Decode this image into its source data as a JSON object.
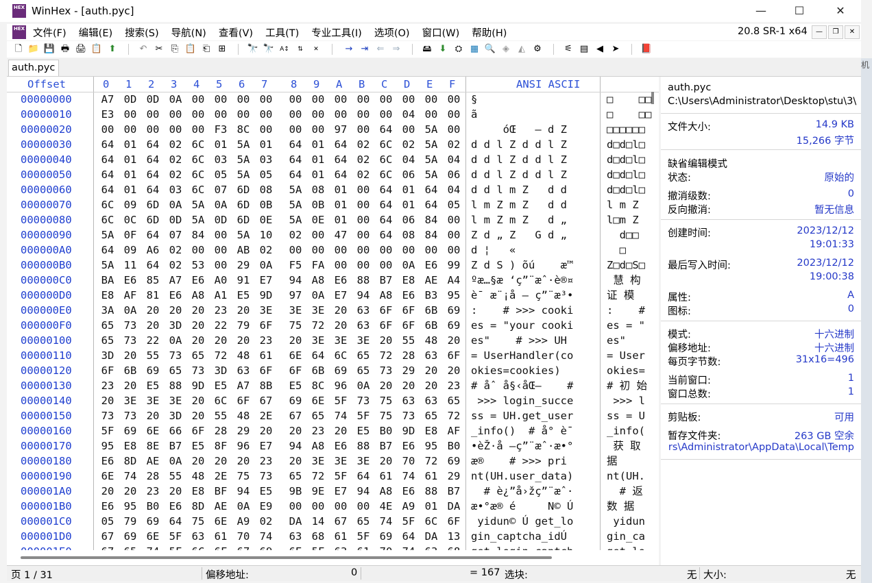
{
  "window": {
    "title": "WinHex - [auth.pyc]",
    "logo_text": "HEX",
    "minimize": "—",
    "maximize": "☐",
    "close": "✕"
  },
  "menu": {
    "items": [
      "文件(F)",
      "编辑(E)",
      "搜索(S)",
      "导航(N)",
      "查看(V)",
      "工具(T)",
      "专业工具(I)",
      "选项(O)",
      "窗口(W)",
      "帮助(H)"
    ],
    "version": "20.8 SR-1 x64"
  },
  "tab": {
    "label": "auth.pyc"
  },
  "side_fragment": "机",
  "hex": {
    "offset_header": "Offset",
    "columns": [
      "0",
      "1",
      "2",
      "3",
      "4",
      "5",
      "6",
      "7",
      "8",
      "9",
      "A",
      "B",
      "C",
      "D",
      "E",
      "F"
    ],
    "ansi_header": "ANSI ASCII",
    "rows": [
      {
        "offset": "00000000",
        "bytes": [
          "A7",
          "0D",
          "0D",
          "0A",
          "00",
          "00",
          "00",
          "00",
          "00",
          "00",
          "00",
          "00",
          "00",
          "00",
          "00",
          "00"
        ],
        "ansi": "§",
        "ascii": "□    □□"
      },
      {
        "offset": "00000010",
        "bytes": [
          "E3",
          "00",
          "00",
          "00",
          "00",
          "00",
          "00",
          "00",
          "00",
          "00",
          "00",
          "00",
          "00",
          "04",
          "00",
          "00"
        ],
        "ansi": "ã",
        "ascii": "□    □□"
      },
      {
        "offset": "00000020",
        "bytes": [
          "00",
          "00",
          "00",
          "00",
          "00",
          "F3",
          "8C",
          "00",
          "00",
          "00",
          "97",
          "00",
          "64",
          "00",
          "5A",
          "00"
        ],
        "ansi": "     óŒ   — d Z",
        "ascii": "□□□□□□"
      },
      {
        "offset": "00000030",
        "bytes": [
          "64",
          "01",
          "64",
          "02",
          "6C",
          "01",
          "5A",
          "01",
          "64",
          "01",
          "64",
          "02",
          "6C",
          "02",
          "5A",
          "02"
        ],
        "ansi": "d d l Z d d l Z",
        "ascii": "d□d□l□"
      },
      {
        "offset": "00000040",
        "bytes": [
          "64",
          "01",
          "64",
          "02",
          "6C",
          "03",
          "5A",
          "03",
          "64",
          "01",
          "64",
          "02",
          "6C",
          "04",
          "5A",
          "04"
        ],
        "ansi": "d d l Z d d l Z",
        "ascii": "d□d□l□"
      },
      {
        "offset": "00000050",
        "bytes": [
          "64",
          "01",
          "64",
          "02",
          "6C",
          "05",
          "5A",
          "05",
          "64",
          "01",
          "64",
          "02",
          "6C",
          "06",
          "5A",
          "06"
        ],
        "ansi": "d d l Z d d l Z",
        "ascii": "d□d□l□"
      },
      {
        "offset": "00000060",
        "bytes": [
          "64",
          "01",
          "64",
          "03",
          "6C",
          "07",
          "6D",
          "08",
          "5A",
          "08",
          "01",
          "00",
          "64",
          "01",
          "64",
          "04"
        ],
        "ansi": "d d l m Z   d d",
        "ascii": "d□d□l□"
      },
      {
        "offset": "00000070",
        "bytes": [
          "6C",
          "09",
          "6D",
          "0A",
          "5A",
          "0A",
          "6D",
          "0B",
          "5A",
          "0B",
          "01",
          "00",
          "64",
          "01",
          "64",
          "05"
        ],
        "ansi": "l m Z m Z   d d",
        "ascii": "l m Z"
      },
      {
        "offset": "00000080",
        "bytes": [
          "6C",
          "0C",
          "6D",
          "0D",
          "5A",
          "0D",
          "6D",
          "0E",
          "5A",
          "0E",
          "01",
          "00",
          "64",
          "06",
          "84",
          "00"
        ],
        "ansi": "l m Z m Z   d „",
        "ascii": "l□m Z"
      },
      {
        "offset": "00000090",
        "bytes": [
          "5A",
          "0F",
          "64",
          "07",
          "84",
          "00",
          "5A",
          "10",
          "02",
          "00",
          "47",
          "00",
          "64",
          "08",
          "84",
          "00"
        ],
        "ansi": "Z d „ Z   G d „",
        "ascii": "  d□□"
      },
      {
        "offset": "000000A0",
        "bytes": [
          "64",
          "09",
          "A6",
          "02",
          "00",
          "00",
          "AB",
          "02",
          "00",
          "00",
          "00",
          "00",
          "00",
          "00",
          "00",
          "00"
        ],
        "ansi": "d ¦   «",
        "ascii": "  □"
      },
      {
        "offset": "000000B0",
        "bytes": [
          "5A",
          "11",
          "64",
          "02",
          "53",
          "00",
          "29",
          "0A",
          "F5",
          "FA",
          "00",
          "00",
          "00",
          "0A",
          "E6",
          "99"
        ],
        "ansi": "Z d S ) õú    æ™",
        "ascii": "Z□d□S□"
      },
      {
        "offset": "000000C0",
        "bytes": [
          "BA",
          "E6",
          "85",
          "A7",
          "E6",
          "A0",
          "91",
          "E7",
          "94",
          "A8",
          "E6",
          "88",
          "B7",
          "E8",
          "AE",
          "A4"
        ],
        "ansi": "ºæ…§æ ‘ç”¨æˆ·è®¤",
        "ascii": " 慧 构"
      },
      {
        "offset": "000000D0",
        "bytes": [
          "E8",
          "AF",
          "81",
          "E6",
          "A8",
          "A1",
          "E5",
          "9D",
          "97",
          "0A",
          "E7",
          "94",
          "A8",
          "E6",
          "B3",
          "95"
        ],
        "ansi": "è¯ æ¨¡å — ç”¨æ³•",
        "ascii": "证 模"
      },
      {
        "offset": "000000E0",
        "bytes": [
          "3A",
          "0A",
          "20",
          "20",
          "20",
          "23",
          "20",
          "3E",
          "3E",
          "3E",
          "20",
          "63",
          "6F",
          "6F",
          "6B",
          "69"
        ],
        "ansi": ":    # >>> cooki",
        "ascii": ":    #"
      },
      {
        "offset": "000000F0",
        "bytes": [
          "65",
          "73",
          "20",
          "3D",
          "20",
          "22",
          "79",
          "6F",
          "75",
          "72",
          "20",
          "63",
          "6F",
          "6F",
          "6B",
          "69"
        ],
        "ansi": "es = \"your cooki",
        "ascii": "es = \""
      },
      {
        "offset": "00000100",
        "bytes": [
          "65",
          "73",
          "22",
          "0A",
          "20",
          "20",
          "20",
          "23",
          "20",
          "3E",
          "3E",
          "3E",
          "20",
          "55",
          "48",
          "20"
        ],
        "ansi": "es\"    # >>> UH ",
        "ascii": "es\""
      },
      {
        "offset": "00000110",
        "bytes": [
          "3D",
          "20",
          "55",
          "73",
          "65",
          "72",
          "48",
          "61",
          "6E",
          "64",
          "6C",
          "65",
          "72",
          "28",
          "63",
          "6F"
        ],
        "ansi": "= UserHandler(co",
        "ascii": "= User"
      },
      {
        "offset": "00000120",
        "bytes": [
          "6F",
          "6B",
          "69",
          "65",
          "73",
          "3D",
          "63",
          "6F",
          "6F",
          "6B",
          "69",
          "65",
          "73",
          "29",
          "20",
          "20"
        ],
        "ansi": "okies=cookies)  ",
        "ascii": "okies="
      },
      {
        "offset": "00000130",
        "bytes": [
          "23",
          "20",
          "E5",
          "88",
          "9D",
          "E5",
          "A7",
          "8B",
          "E5",
          "8C",
          "96",
          "0A",
          "20",
          "20",
          "20",
          "23"
        ],
        "ansi": "# åˆ å§‹åŒ–    #",
        "ascii": "# 初 始"
      },
      {
        "offset": "00000140",
        "bytes": [
          "20",
          "3E",
          "3E",
          "3E",
          "20",
          "6C",
          "6F",
          "67",
          "69",
          "6E",
          "5F",
          "73",
          "75",
          "63",
          "63",
          "65"
        ],
        "ansi": " >>> login_succe",
        "ascii": " >>> l"
      },
      {
        "offset": "00000150",
        "bytes": [
          "73",
          "73",
          "20",
          "3D",
          "20",
          "55",
          "48",
          "2E",
          "67",
          "65",
          "74",
          "5F",
          "75",
          "73",
          "65",
          "72"
        ],
        "ansi": "ss = UH.get_user",
        "ascii": "ss = U"
      },
      {
        "offset": "00000160",
        "bytes": [
          "5F",
          "69",
          "6E",
          "66",
          "6F",
          "28",
          "29",
          "20",
          "20",
          "23",
          "20",
          "E5",
          "B0",
          "9D",
          "E8",
          "AF"
        ],
        "ansi": "_info()  # å° è¯",
        "ascii": "_info("
      },
      {
        "offset": "00000170",
        "bytes": [
          "95",
          "E8",
          "8E",
          "B7",
          "E5",
          "8F",
          "96",
          "E7",
          "94",
          "A8",
          "E6",
          "88",
          "B7",
          "E6",
          "95",
          "B0"
        ],
        "ansi": "•èŽ·å –ç”¨æˆ·æ•°",
        "ascii": " 获 取"
      },
      {
        "offset": "00000180",
        "bytes": [
          "E6",
          "8D",
          "AE",
          "0A",
          "20",
          "20",
          "20",
          "23",
          "20",
          "3E",
          "3E",
          "3E",
          "20",
          "70",
          "72",
          "69"
        ],
        "ansi": "æ®    # >>> pri",
        "ascii": "据"
      },
      {
        "offset": "00000190",
        "bytes": [
          "6E",
          "74",
          "28",
          "55",
          "48",
          "2E",
          "75",
          "73",
          "65",
          "72",
          "5F",
          "64",
          "61",
          "74",
          "61",
          "29"
        ],
        "ansi": "nt(UH.user_data)",
        "ascii": "nt(UH."
      },
      {
        "offset": "000001A0",
        "bytes": [
          "20",
          "20",
          "23",
          "20",
          "E8",
          "BF",
          "94",
          "E5",
          "9B",
          "9E",
          "E7",
          "94",
          "A8",
          "E6",
          "88",
          "B7"
        ],
        "ansi": "  # è¿”å›žç”¨æˆ·",
        "ascii": "  # 返"
      },
      {
        "offset": "000001B0",
        "bytes": [
          "E6",
          "95",
          "B0",
          "E6",
          "8D",
          "AE",
          "0A",
          "E9",
          "00",
          "00",
          "00",
          "00",
          "4E",
          "A9",
          "01",
          "DA"
        ],
        "ansi": "æ•°æ® é     N© Ú",
        "ascii": "数 据"
      },
      {
        "offset": "000001C0",
        "bytes": [
          "05",
          "79",
          "69",
          "64",
          "75",
          "6E",
          "A9",
          "02",
          "DA",
          "14",
          "67",
          "65",
          "74",
          "5F",
          "6C",
          "6F"
        ],
        "ansi": " yidun© Ú get_lo",
        "ascii": " yidun"
      },
      {
        "offset": "000001D0",
        "bytes": [
          "67",
          "69",
          "6E",
          "5F",
          "63",
          "61",
          "70",
          "74",
          "63",
          "68",
          "61",
          "5F",
          "69",
          "64",
          "DA",
          "13"
        ],
        "ansi": "gin_captcha_idÚ ",
        "ascii": "gin_ca"
      },
      {
        "offset": "000001E0",
        "bytes": [
          "67",
          "65",
          "74",
          "5F",
          "6C",
          "6F",
          "67",
          "69",
          "6E",
          "5F",
          "63",
          "61",
          "70",
          "74",
          "63",
          "68"
        ],
        "ansi": "get_login_captch",
        "ascii": "get_lo"
      }
    ]
  },
  "info": {
    "filename": "auth.pyc",
    "path": "C:\\Users\\Administrator\\Desktop\\stu\\3\\",
    "file_size_label": "文件大小:",
    "file_size_kb": "14.9 KB",
    "file_size_bytes": "15,266 字节",
    "edit_mode_label": "缺省编辑模式",
    "state_label": "状态:",
    "state_value": "原始的",
    "undo_level_label": "撤消级数:",
    "undo_level_value": "0",
    "reverse_undo_label": "反向撤消:",
    "reverse_undo_value": "暂无信息",
    "created_label": "创建时间:",
    "created_date": "2023/12/12",
    "created_time": "19:01:33",
    "modified_label": "最后写入时间:",
    "modified_date": "2023/12/12",
    "modified_time": "19:00:38",
    "attr_label": "属性:",
    "attr_value": "A",
    "icon_label": "图标:",
    "icon_value": "0",
    "mode_label": "模式:",
    "mode_value": "十六进制",
    "offset_label": "偏移地址:",
    "offset_value": "十六进制",
    "bytes_per_page_label": "每页字节数:",
    "bytes_per_page_value": "31x16=496",
    "cur_window_label": "当前窗口:",
    "cur_window_value": "1",
    "total_windows_label": "窗口总数:",
    "total_windows_value": "1",
    "clipboard_label": "剪贴板:",
    "clipboard_value": "可用",
    "temp_label": "暂存文件夹:",
    "temp_value": "263 GB 空余",
    "temp_path": "rs\\Administrator\\AppData\\Local\\Temp"
  },
  "status": {
    "page": "页 1 / 31",
    "offset_label": "偏移地址:",
    "offset_value": "0",
    "value": "= 167",
    "block_label": "选块:",
    "block_value": "无",
    "size_label": "大小:",
    "size_value": "无"
  }
}
